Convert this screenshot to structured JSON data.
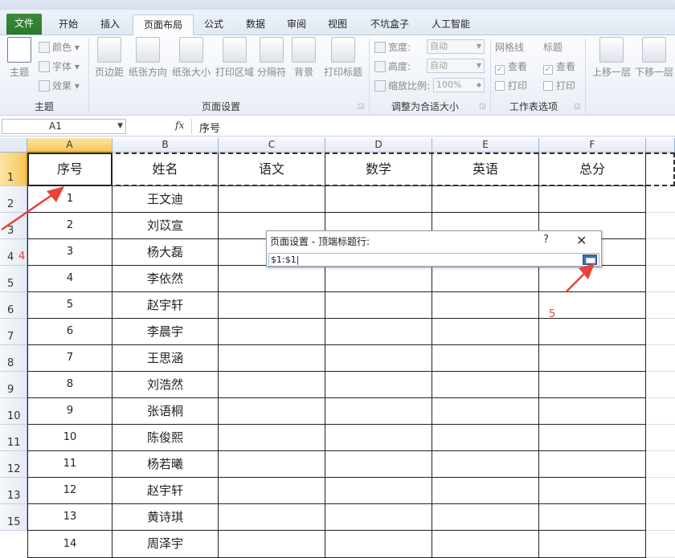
{
  "ribbon_tabs": [
    "文件",
    "开始",
    "插入",
    "页面布局",
    "公式",
    "数据",
    "审阅",
    "视图",
    "不坑盒子",
    "人工智能"
  ],
  "ribbon": {
    "theme_group": {
      "label": "主题",
      "theme_button": "主题",
      "colors": "颜色",
      "fonts": "字体",
      "effects": "效果"
    },
    "page_setup_group": {
      "label": "页面设置",
      "buttons": [
        "页边距",
        "纸张方向",
        "纸张大小",
        "打印区域",
        "分隔符",
        "背景",
        "打印标题"
      ]
    },
    "scale_group": {
      "label": "调整为合适大小",
      "width_label": "宽度:",
      "width_value": "自动",
      "height_label": "高度:",
      "height_value": "自动",
      "scale_label": "缩放比例:",
      "scale_value": "100%"
    },
    "sheet_options_group": {
      "label": "工作表选项",
      "gridlines": "网格线",
      "headings": "标题",
      "view": "查看",
      "print": "打印"
    },
    "arrange_group": {
      "bring_forward": "上移一层",
      "send_backward": "下移一层"
    }
  },
  "formula_bar": {
    "cell_ref": "A1",
    "fx": "fx",
    "content": "序号"
  },
  "columns": [
    "A",
    "B",
    "C",
    "D",
    "E",
    "F"
  ],
  "row_numbers": [
    "1",
    "2",
    "3",
    "4",
    "5",
    "6",
    "7",
    "8",
    "9",
    "10",
    "11",
    "12",
    "13",
    "15"
  ],
  "table": {
    "headers": [
      "序号",
      "姓名",
      "语文",
      "数学",
      "英语",
      "总分"
    ],
    "rows": [
      [
        "1",
        "王文迪"
      ],
      [
        "2",
        "刘苡宣"
      ],
      [
        "3",
        "杨大磊"
      ],
      [
        "4",
        "李依然"
      ],
      [
        "5",
        "赵宇轩"
      ],
      [
        "6",
        "李晨宇"
      ],
      [
        "7",
        "王思涵"
      ],
      [
        "8",
        "刘浩然"
      ],
      [
        "9",
        "张语桐"
      ],
      [
        "10",
        "陈俊熙"
      ],
      [
        "11",
        "杨若曦"
      ],
      [
        "12",
        "赵宇轩"
      ],
      [
        "13",
        "黄诗琪"
      ],
      [
        "14",
        "周泽宇"
      ]
    ]
  },
  "dialog": {
    "title": "页面设置 - 顶端标题行:",
    "help": "?",
    "close": "✕",
    "value": "$1:$1"
  },
  "annotations": {
    "step4": "4",
    "step5": "5",
    "color": "#e8423b"
  }
}
